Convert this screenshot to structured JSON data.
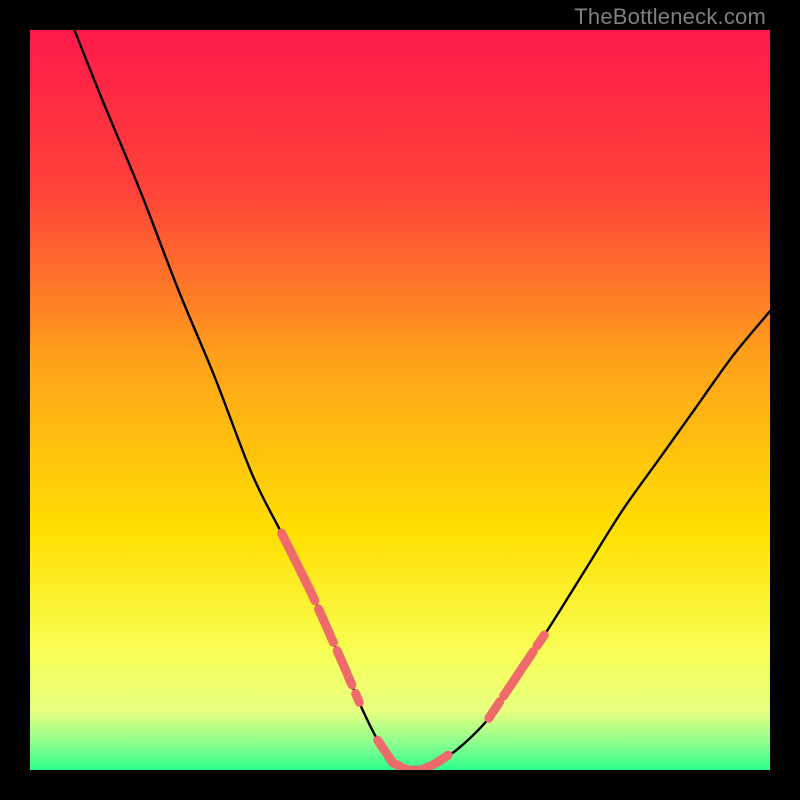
{
  "watermark": "TheBottleneck.com",
  "colors": {
    "bg_black": "#000000",
    "grad_top": "#ff1a4a",
    "grad_mid1": "#ff6a2a",
    "grad_mid2": "#ffb000",
    "grad_mid3": "#ffe000",
    "grad_low": "#f8ff55",
    "grad_green": "#2bff8a",
    "curve": "#000000",
    "dash": "#ef6a6a"
  },
  "chart_data": {
    "type": "line",
    "title": "",
    "xlabel": "",
    "ylabel": "",
    "xlim": [
      0,
      100
    ],
    "ylim": [
      0,
      100
    ],
    "series": [
      {
        "name": "bottleneck-curve",
        "x": [
          6,
          10,
          15,
          20,
          25,
          30,
          34,
          38,
          42,
          45,
          47,
          49,
          51,
          53,
          55,
          58,
          62,
          66,
          70,
          75,
          80,
          85,
          90,
          95,
          100
        ],
        "y": [
          100,
          90,
          78,
          65,
          53,
          40,
          32,
          24,
          15,
          8,
          4,
          1,
          0,
          0,
          1,
          3,
          7,
          13,
          19,
          27,
          35,
          42,
          49,
          56,
          62
        ]
      }
    ],
    "dashed_segments_x": [
      [
        34,
        38.5
      ],
      [
        39,
        41
      ],
      [
        41.5,
        43.5
      ],
      [
        44,
        44.5
      ],
      [
        47,
        50
      ],
      [
        50.5,
        54
      ],
      [
        54.5,
        56.5
      ],
      [
        62,
        63.5
      ],
      [
        64,
        68
      ],
      [
        68.5,
        69.5
      ]
    ],
    "gradient_stops": [
      {
        "pct": 0,
        "hex": "#ff1a4a"
      },
      {
        "pct": 22,
        "hex": "#ff4338"
      },
      {
        "pct": 45,
        "hex": "#ffa31a"
      },
      {
        "pct": 68,
        "hex": "#ffe000"
      },
      {
        "pct": 84,
        "hex": "#f8ff55"
      },
      {
        "pct": 92,
        "hex": "#e8ff80"
      },
      {
        "pct": 97,
        "hex": "#7dff8f"
      },
      {
        "pct": 100,
        "hex": "#2bff8a"
      }
    ]
  }
}
